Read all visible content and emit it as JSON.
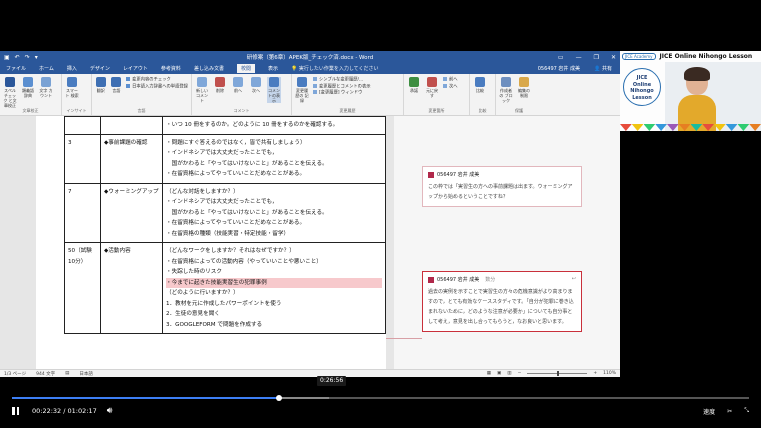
{
  "word": {
    "window_title": "研修案（第6章）APEK版_チェック済.docx - Word",
    "tabs": [
      "ファイル",
      "ホーム",
      "挿入",
      "デザイン",
      "レイアウト",
      "参考資料",
      "差し込み文書",
      "校閲",
      "表示"
    ],
    "active_tab": "校閲",
    "tell_me": "実行したい作業を入力してください",
    "user": "056497 岩井 成美",
    "share": "共有",
    "ribbon": {
      "groups": [
        {
          "name": "文章校正",
          "buttons": [
            "スペル チェック と文章校正",
            "類義語 辞典",
            "文字 カウント"
          ]
        },
        {
          "name": "インサイト",
          "buttons": [
            "スマート 検索"
          ]
        },
        {
          "name": "言語",
          "buttons": [
            "翻訳",
            "言語"
          ],
          "small": [
            "変更内容のチェック",
            "日本語入力辞書への単語登録"
          ]
        },
        {
          "name": "コメント",
          "buttons": [
            "新しい コメント",
            "削除",
            "前へ",
            "次へ",
            "コメントの表示"
          ]
        },
        {
          "name": "変更履歴",
          "buttons": [
            "変更履歴の 記録"
          ],
          "small": [
            "シンプルな変更履歴/...",
            "変更履歴とコメントの表示",
            "[変更履歴] ウィンドウ"
          ]
        },
        {
          "name": "変更箇所",
          "buttons": [
            "承諾",
            "元に戻す"
          ],
          "small": [
            "前へ",
            "次へ"
          ]
        },
        {
          "name": "比較",
          "buttons": [
            "比較"
          ]
        },
        {
          "name": "保護",
          "buttons": [
            "作成者の ブロック",
            "編集の 制限"
          ]
        }
      ]
    },
    "table": {
      "rows": [
        {
          "num": "",
          "title": "",
          "lines": [
            "・いつ 10 冊をするのか。どのように 10 冊をするのかを確認する。"
          ]
        },
        {
          "num": "3",
          "title": "◆事前課題の確認",
          "lines": [
            "・問題にすぐ答えるのではなく，皆で共有しましょう）",
            "・インドネシアでは大丈夫だったことでも，",
            "　国がかわると「やってはいけないこと」があることを伝える。",
            "・在留資格によってやっていいことだめなことがある。"
          ]
        },
        {
          "num": "7",
          "title": "◆ウォーミングアップ",
          "lines": [
            "（どんな対話をしますか？）",
            "・インドネシアでは大丈夫だったことでも，",
            "　国がかわると「やってはいけないこと」があることを伝える。",
            "・在留資格によってやっていいことだめなことがある。",
            "・在留資格の種類（技能実習・特定技能・留学）"
          ]
        },
        {
          "num": "50（試験10分）",
          "title": "◆活動内容",
          "lines": [
            "（どんなワークをしますか？それはなぜですか？）",
            "・在留資格によっての活動内容（やっていいことや悪いこと）",
            "・失踪した時のリスク",
            "・今までに起きた技能実習生の犯罪事例",
            "（どのように行いますか？）",
            "1．教材を元に作成したパワーポイントを使う",
            "2．生徒の意見を聞く",
            "3．GOOGLEFORM で問題を作成する"
          ]
        }
      ]
    },
    "comments": [
      {
        "author": "056497 岩井 成美",
        "time": "",
        "text": "この枠では「実習生の方への事前課題は出ます。ウォーミングアップから始めるということですね？"
      },
      {
        "author": "056497 岩井 成美",
        "time": "数分",
        "text": "過去の実例を示すことで実習生の方々の危機意識がより高まりますので，とても有効なケーススタディです。「自分が犯罪に巻き込まれないために，どのような注意が必要か」についても自分事として考え，意見を出し合ってもらうと，なお良いと思います。"
      }
    ],
    "status": {
      "page": "1/3 ページ",
      "words": "944 文字",
      "lang": "日本語",
      "zoom": "110%"
    }
  },
  "webcam": {
    "logo": "JICE Academy",
    "banner_title": "JICE Online Nihongo Lesson",
    "lesson_logo": [
      "JICE",
      "Online",
      "Nihongo",
      "Lesson"
    ]
  },
  "player": {
    "current_time": "00:22:32",
    "duration": "01:02:17",
    "hover_time": "0:26:56",
    "progress": 0.362,
    "buffered": 0.43,
    "speed_label": "速度",
    "icons": [
      "pause-icon",
      "volume-icon",
      "speed-icon",
      "settings-icon",
      "fullscreen-exit-icon"
    ]
  },
  "colors": {
    "word_blue": "#2b579a",
    "progress_blue": "#3d7ff5",
    "comment_red": "#c9303b"
  }
}
